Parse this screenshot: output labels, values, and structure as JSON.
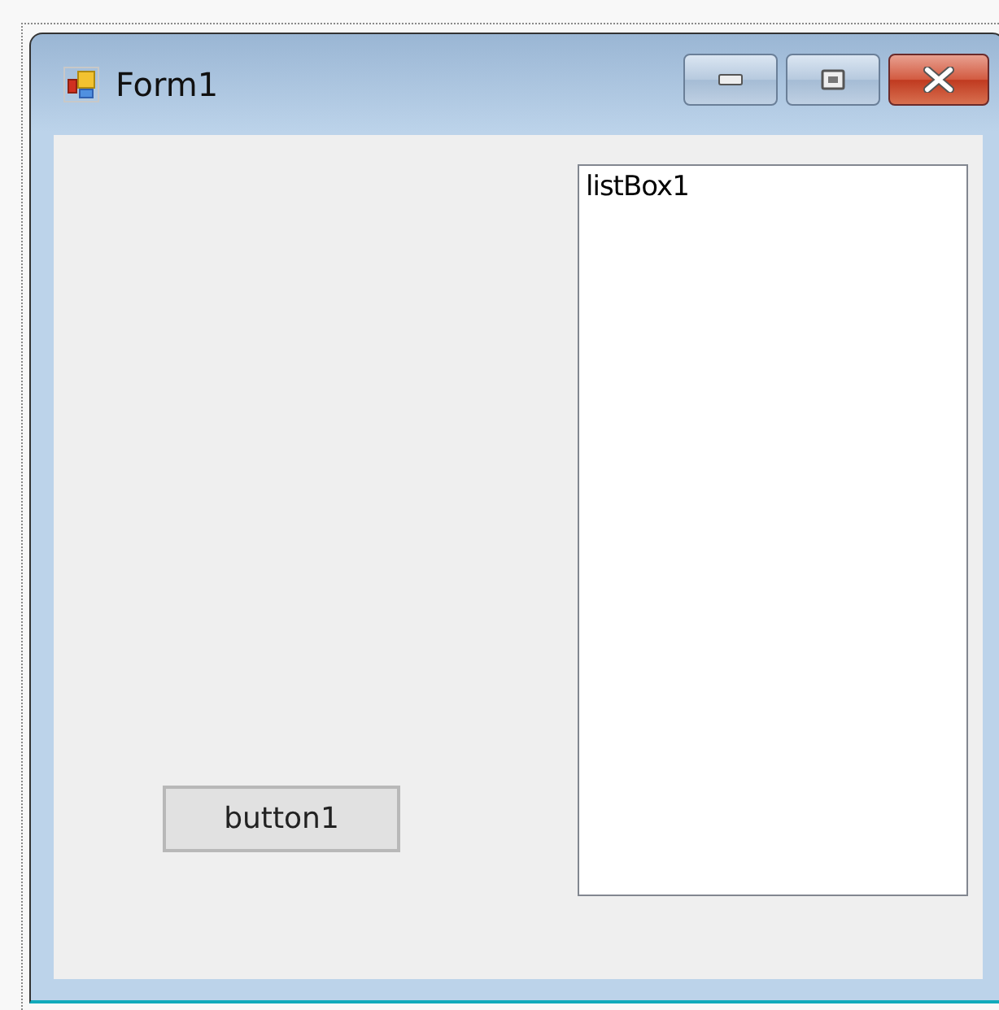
{
  "window": {
    "title": "Form1"
  },
  "controls": [
    {
      "kind": "listbox",
      "text": "listBox1"
    },
    {
      "kind": "button",
      "text": "button1"
    }
  ]
}
